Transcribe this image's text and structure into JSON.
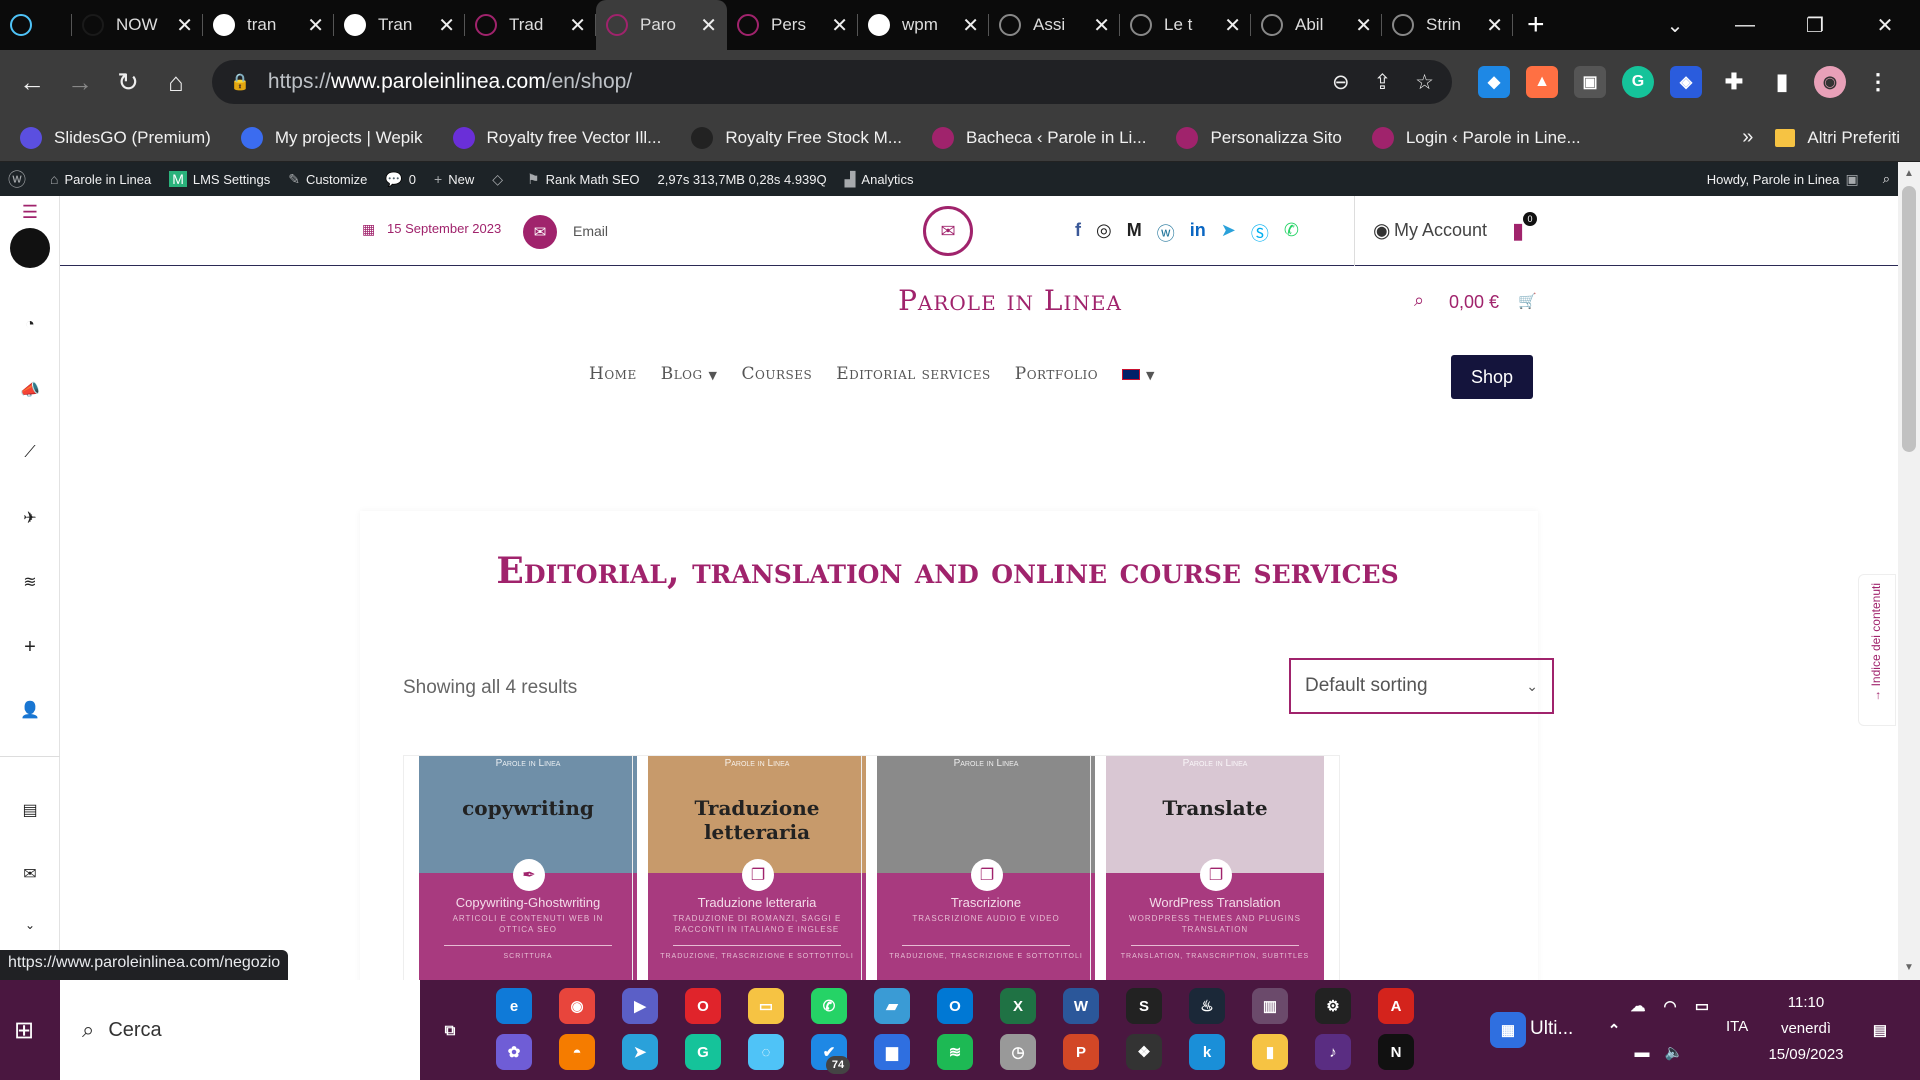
{
  "browser": {
    "tabs": [
      {
        "title": "",
        "icon": "gem-icon",
        "color": "#4fc3f7"
      },
      {
        "title": "NOW",
        "icon": "now-icon",
        "color": "#1a1a1a"
      },
      {
        "title": "tran",
        "icon": "wordpress-icon",
        "color": "#fff"
      },
      {
        "title": "Tran",
        "icon": "wordpress-icon",
        "color": "#fff"
      },
      {
        "title": "Trad",
        "icon": "site-icon",
        "color": "#a0236c"
      },
      {
        "title": "Paro",
        "icon": "site-icon",
        "color": "#a0236c"
      },
      {
        "title": "Pers",
        "icon": "site-icon",
        "color": "#a0236c"
      },
      {
        "title": "wpm",
        "icon": "google-icon",
        "color": "#fff"
      },
      {
        "title": "Assi",
        "icon": "spinner-icon",
        "color": "#888"
      },
      {
        "title": "Le t",
        "icon": "spinner-icon",
        "color": "#888"
      },
      {
        "title": "Abil",
        "icon": "spinner-icon",
        "color": "#888"
      },
      {
        "title": "Strin",
        "icon": "spinner-icon",
        "color": "#888"
      }
    ],
    "url_prefix": "https://",
    "url_host": "www.paroleinlinea.com",
    "url_path": "/en/shop/",
    "bookmarks": [
      {
        "label": "SlidesGO (Premium)",
        "color": "#5b4fe0"
      },
      {
        "label": "My projects | Wepik",
        "color": "#3b6cf0"
      },
      {
        "label": "Royalty free Vector Ill...",
        "color": "#6a2fd8"
      },
      {
        "label": "Royalty Free Stock M...",
        "color": "#222"
      },
      {
        "label": "Bacheca ‹ Parole in Li...",
        "color": "#a0236c"
      },
      {
        "label": "Personalizza Sito",
        "color": "#a0236c"
      },
      {
        "label": "Login ‹ Parole in Line...",
        "color": "#a0236c"
      }
    ],
    "more": "»",
    "other_bookmarks": "Altri Preferiti",
    "status_url": "https://www.paroleinlinea.com/negozio"
  },
  "adminbar": {
    "site": "Parole in Linea",
    "lms": "LMS Settings",
    "customize": "Customize",
    "comments": "0",
    "new": "New",
    "rankmath": "Rank Math SEO",
    "stats": "2,97s  313,7MB  0,28s  4.939Q",
    "analytics": "Analytics",
    "howdy": "Howdy, Parole in Linea"
  },
  "site": {
    "date": "15 September 2023",
    "email": "Email",
    "title": "Parole in Linea",
    "account": "My Account",
    "cart_count": "0",
    "cart_total": "0,00 €",
    "menu": [
      "Home",
      "Blog",
      "Courses",
      "Editorial services",
      "Portfolio"
    ],
    "shop": "Shop",
    "heading": "Editorial, translation and online course services",
    "results": "Showing all 4 results",
    "sorting": "Default sorting",
    "toc": "Indice dei contenuti",
    "products": [
      {
        "brand": "Parole in Linea",
        "title": "Copywriting-Ghostwriting",
        "sub": "Articoli e contenuti web in ottica SEO",
        "cat": "Scrittura",
        "img_text": "copywriting",
        "img_bg": "#6f8fa8"
      },
      {
        "brand": "Parole in Linea",
        "title": "Traduzione letteraria",
        "sub": "Traduzione di romanzi, saggi e racconti in italiano e inglese",
        "cat": "Traduzione, Trascrizione e Sottotitoli",
        "img_text": "Traduzione letteraria",
        "img_bg": "#c79a6b"
      },
      {
        "brand": "Parole in Linea",
        "title": "Trascrizione",
        "sub": "Trascrizione audio e video",
        "cat": "Traduzione, Trascrizione e Sottotitoli",
        "img_text": "",
        "img_bg": "#8a8a8a"
      },
      {
        "brand": "Parole in Linea",
        "title": "WordPress Translation",
        "sub": "WordPress themes and plugins translation",
        "cat": "Translation, Transcription, Subtitles",
        "img_text": "Translate",
        "img_bg": "#d9c7d3"
      }
    ]
  },
  "taskbar": {
    "search": "Cerca",
    "notif_label": "Ulti...",
    "lang": "ITA",
    "time": "11:10",
    "day": "venerdì",
    "date": "15/09/2023",
    "badge": "74"
  }
}
